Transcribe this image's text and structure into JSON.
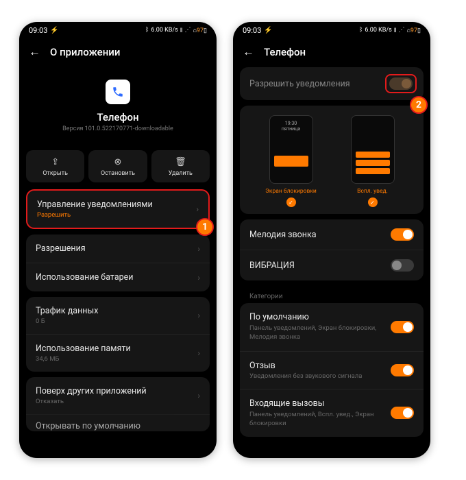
{
  "status": {
    "time": "09:03",
    "bt": "*",
    "speed": "6.00 KB/s",
    "signal": "▯▯◧",
    "wifi": "⊿",
    "battery": "97"
  },
  "left": {
    "header": "О приложении",
    "app_name": "Телефон",
    "version": "Версия 101.0.522170771-downloadable",
    "actions": {
      "open": "Открыть",
      "stop": "Остановить",
      "delete": "Удалить"
    },
    "rows": {
      "notif_mgmt": {
        "title": "Управление уведомлениями",
        "sub": "Разрешить"
      },
      "permissions": "Разрешения",
      "battery": "Использование батареи",
      "traffic": {
        "title": "Трафик данных",
        "sub": "0 Б"
      },
      "memory": {
        "title": "Использование памяти",
        "sub": "34,6 МБ"
      },
      "ontop": {
        "title": "Поверх других приложений",
        "sub": "Отказать"
      },
      "cutoff": "Открывать по умолчанию"
    }
  },
  "right": {
    "header": "Телефон",
    "allow": "Разрешить уведомления",
    "previews": {
      "lock": "Экран блокировки",
      "popup": "Вспл. увед."
    },
    "ringtone": "Мелодия звонка",
    "vibration": "ВИБРАЦИЯ",
    "categories_label": "Категории",
    "cats": {
      "default": {
        "title": "По умолчанию",
        "sub": "Панель уведомлений, Экран блокировки, Мелодия звонка"
      },
      "review": {
        "title": "Отзыв",
        "sub": "Уведомления без звукового сигнала"
      },
      "incoming": {
        "title": "Входящие вызовы",
        "sub": "Панель уведомлений, Вспл. увед., Экран блокировки"
      }
    }
  },
  "badges": {
    "one": "1",
    "two": "2"
  }
}
